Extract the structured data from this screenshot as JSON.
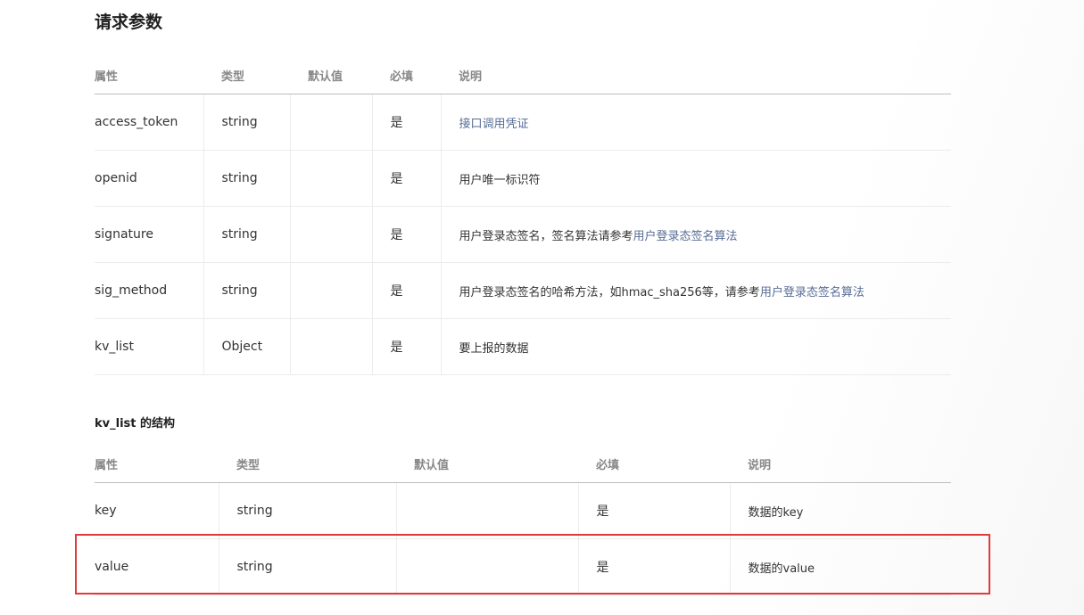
{
  "title": "请求参数",
  "headers": [
    "属性",
    "类型",
    "默认值",
    "必填",
    "说明"
  ],
  "main_table": {
    "rows": [
      {
        "name": "access_token",
        "type": "string",
        "default": "",
        "required": "是",
        "desc_text": "",
        "desc_link": "接口调用凭证"
      },
      {
        "name": "openid",
        "type": "string",
        "default": "",
        "required": "是",
        "desc_text": "用户唯一标识符",
        "desc_link": ""
      },
      {
        "name": "signature",
        "type": "string",
        "default": "",
        "required": "是",
        "desc_text": "用户登录态签名，签名算法请参考",
        "desc_link": "用户登录态签名算法"
      },
      {
        "name": "sig_method",
        "type": "string",
        "default": "",
        "required": "是",
        "desc_text": "用户登录态签名的哈希方法，如hmac_sha256等，请参考",
        "desc_link": "用户登录态签名算法"
      },
      {
        "name": "kv_list",
        "type": "Object",
        "default": "",
        "required": "是",
        "desc_text": "要上报的数据",
        "desc_link": ""
      }
    ]
  },
  "sub_section": {
    "title": "kv_list 的结构",
    "rows": [
      {
        "name": "key",
        "type": "string",
        "default": "",
        "required": "是",
        "desc_text": "数据的key"
      },
      {
        "name": "value",
        "type": "string",
        "default": "",
        "required": "是",
        "desc_text": "数据的value"
      }
    ]
  },
  "colors": {
    "link": "#576b95",
    "highlight": "#e23a3a",
    "header_text": "#888888"
  }
}
